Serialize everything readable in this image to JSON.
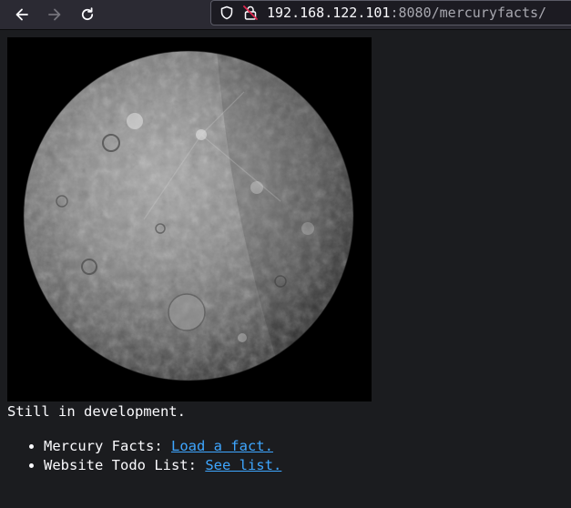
{
  "browser": {
    "url_host": "192.168.122.101",
    "url_rest": ":8080/mercuryfacts/",
    "icons": [
      "back-arrow-icon",
      "forward-arrow-icon",
      "reload-icon",
      "shield-icon",
      "insecure-lock-icon"
    ]
  },
  "page": {
    "image_alt": "Mercury",
    "status": "Still in development.",
    "links": [
      {
        "label": "Mercury Facts: ",
        "link_text": "Load a fact."
      },
      {
        "label": "Website Todo List: ",
        "link_text": "See list."
      }
    ]
  },
  "colors": {
    "page_bg": "#1b1c1f",
    "text": "#fbfbfe",
    "link": "#3ea6ff",
    "toolbar_bg": "#2b2a33"
  }
}
